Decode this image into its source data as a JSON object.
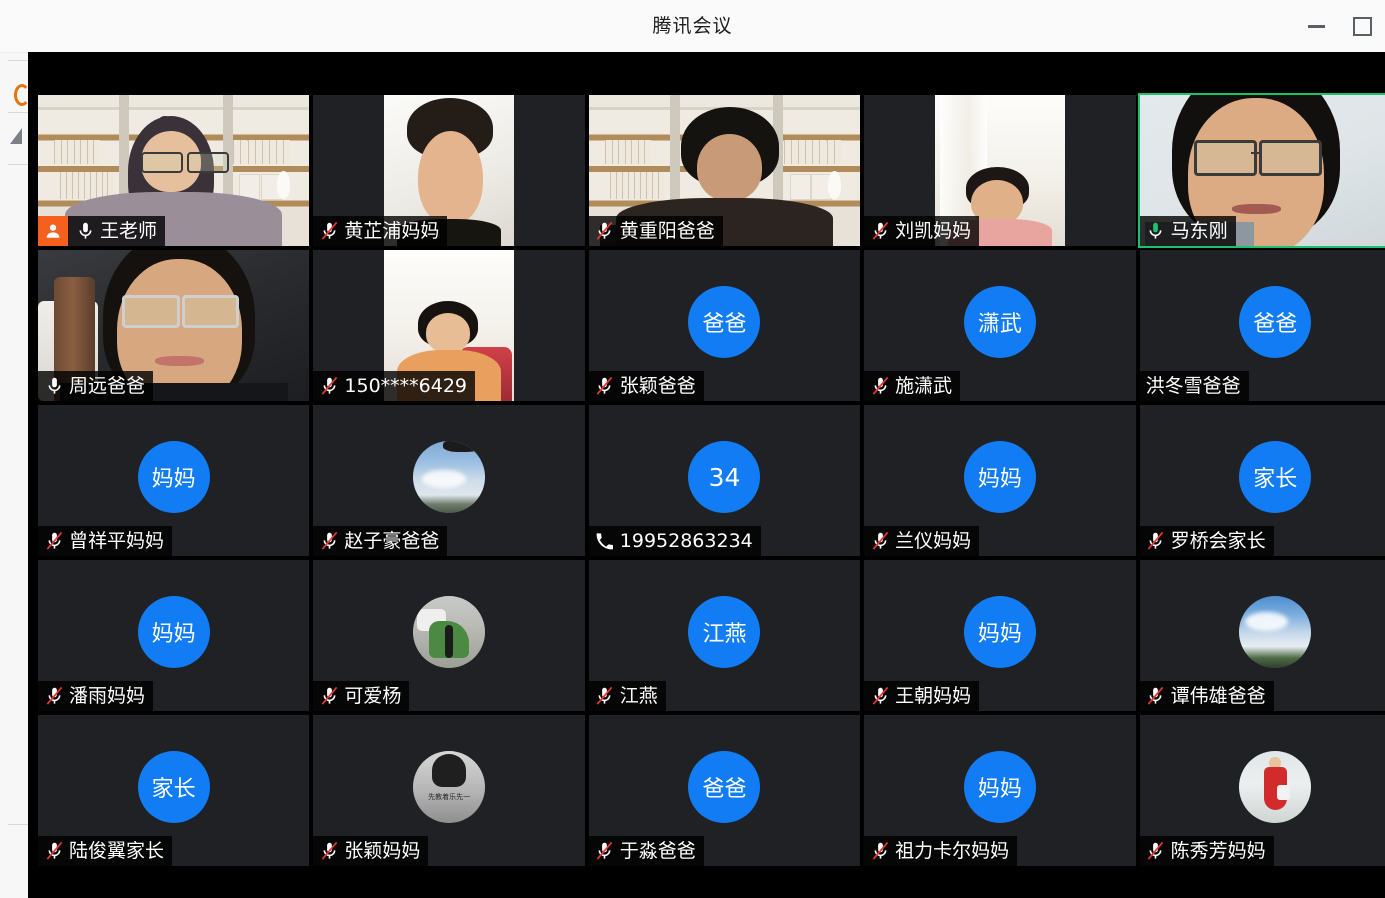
{
  "window": {
    "title": "腾讯会议",
    "controls": [
      {
        "name": "minimize",
        "glyph": "—"
      },
      {
        "name": "maximize",
        "glyph": "▢"
      }
    ]
  },
  "meeting": {
    "layout": {
      "columns": 5,
      "rows": 5,
      "total_tiles": 25
    },
    "colors": {
      "avatar_blue": "#127cf5",
      "host_badge_orange": "#f5601e",
      "speaking_border_green": "#1ec26a",
      "mic_muted_red": "#e5392f",
      "mic_active_green": "#1ec26a",
      "tile_background": "#1f2124",
      "stage_background": "#000000"
    },
    "participants": [
      {
        "name": "王老师",
        "mic": "on",
        "host": true,
        "speaking": false,
        "media": "video",
        "video_style": "shelf-teacher",
        "avatar_text": "",
        "avatar_kind": "none"
      },
      {
        "name": "黄芷浦妈妈",
        "mic": "muted",
        "host": false,
        "speaking": false,
        "media": "video",
        "video_style": "portrait-wall",
        "avatar_text": "",
        "avatar_kind": "none"
      },
      {
        "name": "黄重阳爸爸",
        "mic": "muted",
        "host": false,
        "speaking": false,
        "media": "video",
        "video_style": "shelf-parent",
        "avatar_text": "",
        "avatar_kind": "none"
      },
      {
        "name": "刘凯妈妈",
        "mic": "muted",
        "host": false,
        "speaking": false,
        "media": "video",
        "video_style": "portrait-bright",
        "avatar_text": "",
        "avatar_kind": "none"
      },
      {
        "name": "马东刚",
        "mic": "on",
        "host": false,
        "speaking": true,
        "media": "video",
        "video_style": "man-glasses",
        "avatar_text": "",
        "avatar_kind": "none"
      },
      {
        "name": "周远爸爸",
        "mic": "on",
        "host": false,
        "speaking": false,
        "media": "video",
        "video_style": "dark-bedroom",
        "avatar_text": "",
        "avatar_kind": "none"
      },
      {
        "name": "150****6429",
        "mic": "muted",
        "host": false,
        "speaking": false,
        "media": "video",
        "video_style": "portrait-girl",
        "avatar_text": "",
        "avatar_kind": "none"
      },
      {
        "name": "张颖爸爸",
        "mic": "muted",
        "host": false,
        "speaking": false,
        "media": "avatar",
        "video_style": "",
        "avatar_text": "爸爸",
        "avatar_kind": "text"
      },
      {
        "name": "施潇武",
        "mic": "muted",
        "host": false,
        "speaking": false,
        "media": "avatar",
        "video_style": "",
        "avatar_text": "潇武",
        "avatar_kind": "text"
      },
      {
        "name": "洪冬雪爸爸",
        "mic": "none",
        "host": false,
        "speaking": false,
        "media": "avatar",
        "video_style": "",
        "avatar_text": "爸爸",
        "avatar_kind": "text"
      },
      {
        "name": "曾祥平妈妈",
        "mic": "muted",
        "host": false,
        "speaking": false,
        "media": "avatar",
        "video_style": "",
        "avatar_text": "妈妈",
        "avatar_kind": "text"
      },
      {
        "name": "赵子豪爸爸",
        "mic": "muted",
        "host": false,
        "speaking": false,
        "media": "avatar",
        "video_style": "",
        "avatar_text": "",
        "avatar_kind": "photo-sky"
      },
      {
        "name": "19952863234",
        "mic": "phone",
        "host": false,
        "speaking": false,
        "media": "avatar",
        "video_style": "",
        "avatar_text": "34",
        "avatar_kind": "number"
      },
      {
        "name": "兰仪妈妈",
        "mic": "muted",
        "host": false,
        "speaking": false,
        "media": "avatar",
        "video_style": "",
        "avatar_text": "妈妈",
        "avatar_kind": "text"
      },
      {
        "name": "罗桥会家长",
        "mic": "muted",
        "host": false,
        "speaking": false,
        "media": "avatar",
        "video_style": "",
        "avatar_text": "家长",
        "avatar_kind": "text"
      },
      {
        "name": "潘雨妈妈",
        "mic": "muted",
        "host": false,
        "speaking": false,
        "media": "avatar",
        "video_style": "",
        "avatar_text": "妈妈",
        "avatar_kind": "text"
      },
      {
        "name": "可爱杨",
        "mic": "muted",
        "host": false,
        "speaking": false,
        "media": "avatar",
        "video_style": "",
        "avatar_text": "",
        "avatar_kind": "photo-green"
      },
      {
        "name": "江燕",
        "mic": "muted",
        "host": false,
        "speaking": false,
        "media": "avatar",
        "video_style": "",
        "avatar_text": "江燕",
        "avatar_kind": "text"
      },
      {
        "name": "王朝妈妈",
        "mic": "muted",
        "host": false,
        "speaking": false,
        "media": "avatar",
        "video_style": "",
        "avatar_text": "妈妈",
        "avatar_kind": "text"
      },
      {
        "name": "谭伟雄爸爸",
        "mic": "muted",
        "host": false,
        "speaking": false,
        "media": "avatar",
        "video_style": "",
        "avatar_text": "",
        "avatar_kind": "photo-sky2"
      },
      {
        "name": "陆俊翼家长",
        "mic": "muted",
        "host": false,
        "speaking": false,
        "media": "avatar",
        "video_style": "",
        "avatar_text": "家长",
        "avatar_kind": "text"
      },
      {
        "name": "张颖妈妈",
        "mic": "muted",
        "host": false,
        "speaking": false,
        "media": "avatar",
        "video_style": "",
        "avatar_text": "",
        "avatar_kind": "photo-bw"
      },
      {
        "name": "于淼爸爸",
        "mic": "muted",
        "host": false,
        "speaking": false,
        "media": "avatar",
        "video_style": "",
        "avatar_text": "爸爸",
        "avatar_kind": "text"
      },
      {
        "name": "祖力卡尔妈妈",
        "mic": "muted",
        "host": false,
        "speaking": false,
        "media": "avatar",
        "video_style": "",
        "avatar_text": "妈妈",
        "avatar_kind": "text"
      },
      {
        "name": "陈秀芳妈妈",
        "mic": "muted",
        "host": false,
        "speaking": false,
        "media": "avatar",
        "video_style": "",
        "avatar_text": "",
        "avatar_kind": "photo-red"
      }
    ]
  }
}
